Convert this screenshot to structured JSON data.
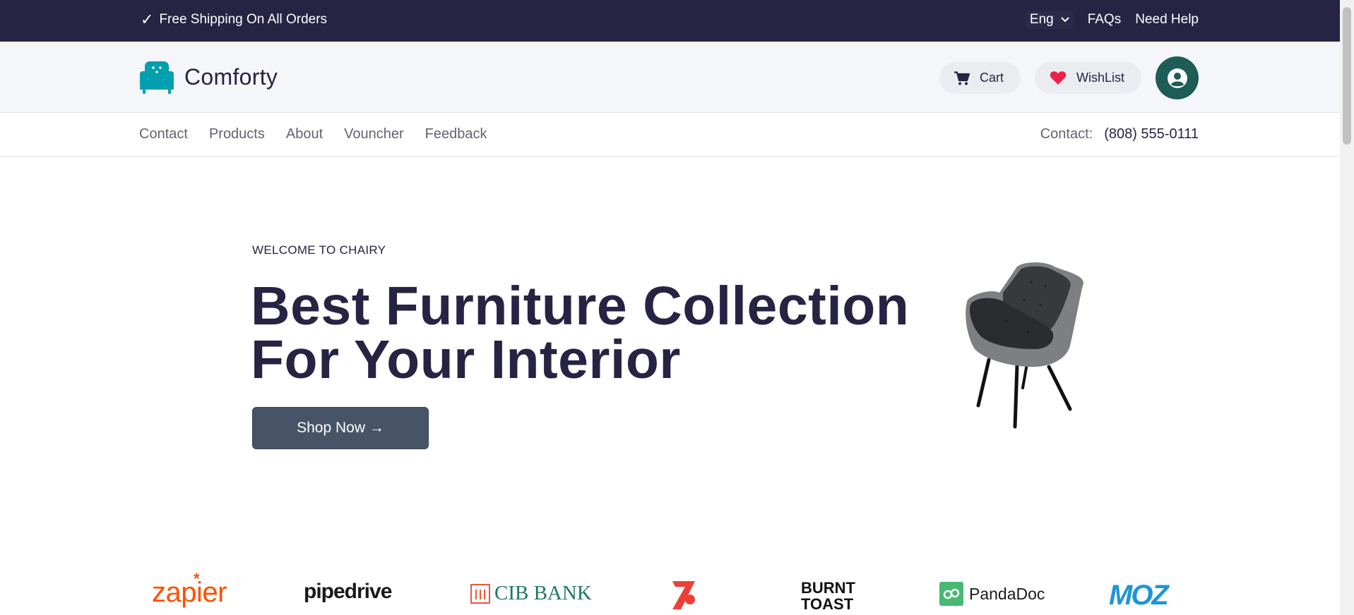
{
  "topbar": {
    "shipping_text": "Free Shipping On All Orders",
    "language": "Eng",
    "faqs": "FAQs",
    "help": "Need Help"
  },
  "header": {
    "brand_name": "Comforty",
    "cart_label": "Cart",
    "wishlist_label": "WishList"
  },
  "nav": {
    "links": [
      "Contact",
      "Products",
      "About",
      "Vouncher",
      "Feedback"
    ],
    "contact_label": "Contact:",
    "phone": "(808) 555-0111"
  },
  "hero": {
    "welcome": "WELCOME TO CHAIRY",
    "title_line1": "Best Furniture Collection",
    "title_line2": "For Your Interior",
    "cta": "Shop Now →"
  },
  "brands": {
    "zapier": "zapier",
    "pipedrive": "pipedrive",
    "cib": "CIB BANK",
    "burnt1": "BURNT",
    "burnt2": "TOAST",
    "pandadoc": "PandaDoc",
    "moz": "MOZ"
  },
  "colors": {
    "primary": "#272343",
    "accent": "#029fae",
    "avatar_bg": "#1d5c57",
    "button_bg": "#475467"
  },
  "icons": [
    "check-icon",
    "chevron-down-icon",
    "sofa-logo-icon",
    "cart-icon",
    "heart-icon",
    "user-icon"
  ]
}
